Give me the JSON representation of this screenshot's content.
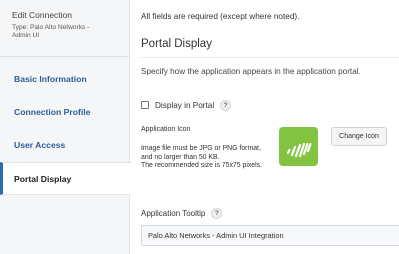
{
  "sidebar": {
    "title": "Edit Connection",
    "type_line1": "Type: Palo Alto Networks -",
    "type_line2": "Admin UI",
    "items": [
      {
        "label": "Basic Information",
        "active": false
      },
      {
        "label": "Connection Profile",
        "active": false
      },
      {
        "label": "User Access",
        "active": false
      },
      {
        "label": "Portal Display",
        "active": true
      }
    ]
  },
  "main": {
    "required_note": "All fields are required (except where noted).",
    "section_title": "Portal Display",
    "section_desc": "Specify how the application appears in the application portal.",
    "display_in_portal": {
      "label": "Display in Portal",
      "checked": false,
      "help": "?"
    },
    "app_icon": {
      "label": "Application Icon",
      "help_lines": [
        "Image file must be JPG or PNG format,",
        "and no larger than 50 KB.",
        "The recommended size is 75x75 pixels."
      ],
      "icon_name": "palo-alto-logo-icon",
      "icon_color": "#82c341",
      "change_button": "Change Icon"
    },
    "tooltip": {
      "label": "Application Tooltip",
      "help": "?",
      "value": "Palo Alto Networks - Admin UI Integration"
    }
  }
}
